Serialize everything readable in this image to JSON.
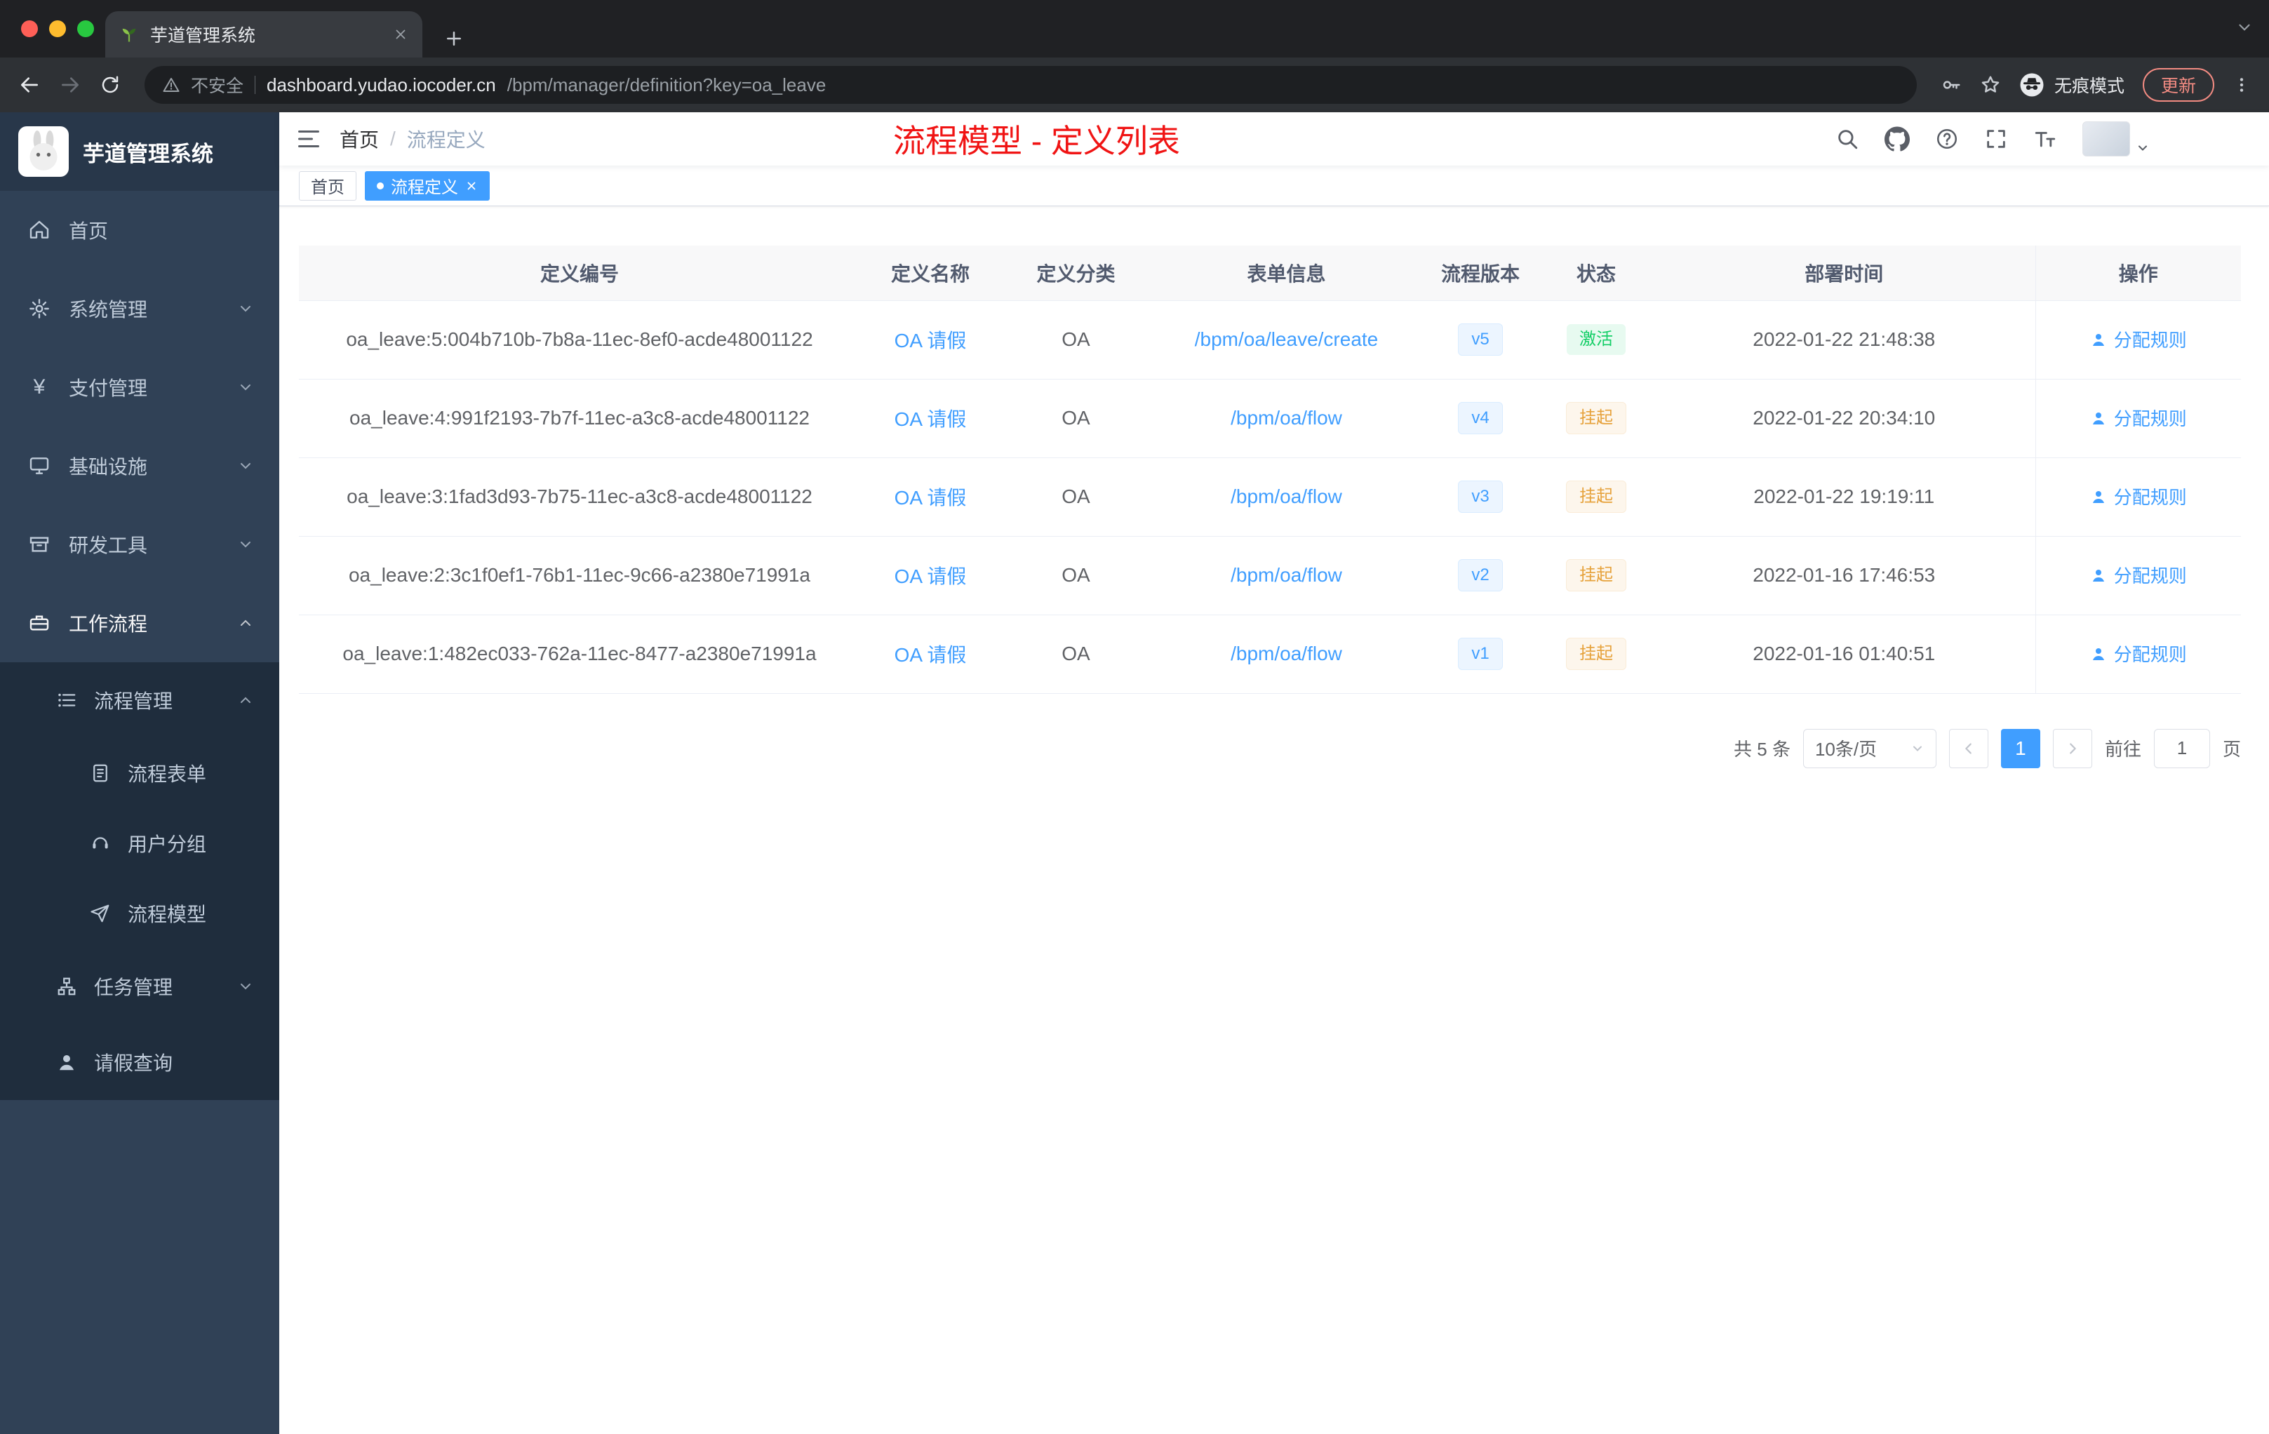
{
  "browser": {
    "tab": {
      "title": "芋道管理系统"
    },
    "address": {
      "security": "不安全",
      "domain": "dashboard.yudao.iocoder.cn",
      "path": "/bpm/manager/definition?key=oa_leave"
    },
    "incognito_label": "无痕模式",
    "update_label": "更新"
  },
  "icons": {
    "yen": "¥"
  },
  "sidebar": {
    "brand": "芋道管理系统",
    "items": [
      {
        "label": "首页"
      },
      {
        "label": "系统管理"
      },
      {
        "label": "支付管理"
      },
      {
        "label": "基础设施"
      },
      {
        "label": "研发工具"
      },
      {
        "label": "工作流程"
      }
    ],
    "submenu": {
      "group_label": "流程管理",
      "children": [
        {
          "label": "流程表单"
        },
        {
          "label": "用户分组"
        },
        {
          "label": "流程模型"
        }
      ],
      "task_label": "任务管理",
      "leave_label": "请假查询"
    }
  },
  "header": {
    "breadcrumb": {
      "home": "首页",
      "separator": "/",
      "current": "流程定义"
    },
    "annotation": "流程模型 - 定义列表"
  },
  "tags": {
    "home": "首页",
    "active": "流程定义"
  },
  "table": {
    "columns": [
      "定义编号",
      "定义名称",
      "定义分类",
      "表单信息",
      "流程版本",
      "状态",
      "部署时间",
      "操作"
    ],
    "rows": [
      {
        "id": "oa_leave:5:004b710b-7b8a-11ec-8ef0-acde48001122",
        "name": "OA 请假",
        "category": "OA",
        "form": "/bpm/oa/leave/create",
        "version": "v5",
        "status": "激活",
        "status_class": "badge badge-success",
        "time": "2022-01-22 21:48:38",
        "action": "分配规则"
      },
      {
        "id": "oa_leave:4:991f2193-7b7f-11ec-a3c8-acde48001122",
        "name": "OA 请假",
        "category": "OA",
        "form": "/bpm/oa/flow",
        "version": "v4",
        "status": "挂起",
        "status_class": "badge badge-warning",
        "time": "2022-01-22 20:34:10",
        "action": "分配规则"
      },
      {
        "id": "oa_leave:3:1fad3d93-7b75-11ec-a3c8-acde48001122",
        "name": "OA 请假",
        "category": "OA",
        "form": "/bpm/oa/flow",
        "version": "v3",
        "status": "挂起",
        "status_class": "badge badge-warning",
        "time": "2022-01-22 19:19:11",
        "action": "分配规则"
      },
      {
        "id": "oa_leave:2:3c1f0ef1-76b1-11ec-9c66-a2380e71991a",
        "name": "OA 请假",
        "category": "OA",
        "form": "/bpm/oa/flow",
        "version": "v2",
        "status": "挂起",
        "status_class": "badge badge-warning",
        "time": "2022-01-16 17:46:53",
        "action": "分配规则"
      },
      {
        "id": "oa_leave:1:482ec033-762a-11ec-8477-a2380e71991a",
        "name": "OA 请假",
        "category": "OA",
        "form": "/bpm/oa/flow",
        "version": "v1",
        "status": "挂起",
        "status_class": "badge badge-warning",
        "time": "2022-01-16 01:40:51",
        "action": "分配规则"
      }
    ]
  },
  "pagination": {
    "total": "共 5 条",
    "page_size": "10条/页",
    "page": "1",
    "goto": "前往",
    "goto_value": "1",
    "unit": "页"
  },
  "colors": {
    "accent": "#409eff",
    "success": "#13ce66",
    "warning": "#e6a23c",
    "annotation_red": "#f01414"
  }
}
